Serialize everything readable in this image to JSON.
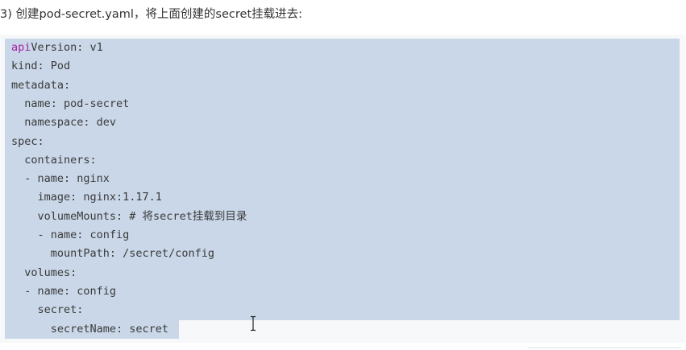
{
  "heading": "3) 创建pod-secret.yaml，将上面创建的secret挂载进去:",
  "code": {
    "first_line_prefix": "api",
    "lines": [
      "apiVersion: v1",
      "kind: Pod",
      "metadata:",
      "  name: pod-secret",
      "  namespace: dev",
      "spec:",
      "  containers:",
      "  - name: nginx",
      "    image: nginx:1.17.1",
      "    volumeMounts: # 将secret挂载到目录",
      "    - name: config",
      "      mountPath: /secret/config",
      "  volumes:",
      "  - name: config",
      "    secret:",
      "      secretName: secret"
    ],
    "first_line_rest": "Version: v1"
  },
  "colors": {
    "selection": "#c9d7e8",
    "panel": "#f6f8fa",
    "accent": "#a626a4",
    "text": "#3a3a3a"
  },
  "icons": {
    "cursor": "text-cursor-icon"
  }
}
